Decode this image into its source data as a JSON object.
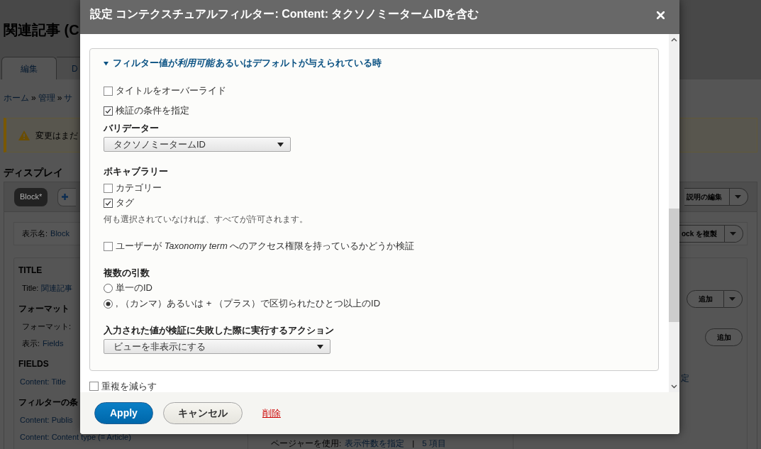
{
  "page": {
    "title": "関連記事 (C",
    "tabs": [
      {
        "label": "編集",
        "selected": true
      },
      {
        "label": "D",
        "selected": false
      }
    ],
    "breadcrumb": [
      {
        "kind": "link",
        "text": "ホーム"
      },
      {
        "kind": "separator",
        "text": "»"
      },
      {
        "kind": "link",
        "text": "管理"
      },
      {
        "kind": "separator",
        "text": "»"
      },
      {
        "kind": "link",
        "text": "サ"
      }
    ],
    "warning": "変更はまだ",
    "displays_heading": "ディスプレイ",
    "display_tabs": [
      {
        "label": "Block*",
        "selected": true
      }
    ],
    "display_menu": {
      "label": "説明の編集",
      "dropdown": true
    },
    "display_name": {
      "label": "表示名:",
      "value": "Block"
    },
    "clone_button": {
      "label": "ock を複製",
      "dropdown": true
    },
    "left_sections": [
      {
        "heading": "TITLE",
        "rows": [
          {
            "label": "Title:",
            "value": "関連記事"
          }
        ]
      },
      {
        "heading": "フォーマット",
        "rows": [
          {
            "label": "フォーマット:"
          },
          {
            "label": "表示:",
            "value": "Fields"
          }
        ]
      },
      {
        "heading": "FIELDS",
        "rows": [
          {
            "value": "Content: Title"
          }
        ]
      },
      {
        "heading": "フィルターの条",
        "rows": [
          {
            "value": "Content: Publis"
          },
          {
            "value": "Content: Content type (= Article)"
          }
        ]
      }
    ],
    "pager": {
      "label": "ページャーを使用:",
      "link": "表示件数を指定",
      "separator": "|",
      "count": "5 項目"
    },
    "right_buttons": [
      {
        "label": "追加",
        "dropdown": true
      },
      {
        "label": "追加",
        "dropdown": false
      }
    ],
    "right_link": "定"
  },
  "dialog": {
    "title": "設定 コンテクスチュアルフィルター: Content: タクソノミータームIDを含む",
    "fieldset": {
      "summary": [
        {
          "text": "フィルター値が",
          "italic": false
        },
        {
          "text": "利用可能",
          "italic": true
        },
        {
          "text": "あるいはデフォルトが与えられている時",
          "italic": false
        }
      ],
      "expanded": true,
      "items": [
        {
          "kind": "checkbox",
          "label": "タイトルをオーバーライド",
          "checked": false
        },
        {
          "kind": "checkbox",
          "label": "検証の条件を指定",
          "checked": true
        },
        {
          "kind": "select",
          "label": "バリデーター",
          "value": "タクソノミータームID"
        },
        {
          "kind": "checkboxes",
          "label": "ボキャブラリー",
          "options": [
            {
              "label": "カテゴリー",
              "checked": false
            },
            {
              "label": "タグ",
              "checked": true
            }
          ],
          "description": "何も選択されていなければ、すべてが許可されます。"
        },
        {
          "kind": "checkbox",
          "label": "ユーザーが *Taxonomy term* へのアクセス権限を持っているかどうか検証",
          "checked": false
        },
        {
          "kind": "radios",
          "label": "複数の引数",
          "options": [
            {
              "label": "単一のID",
              "selected": false
            },
            {
              "label": ", （カンマ）あるいは + （プラス）で区切られたひとつ以上のID",
              "selected": true
            }
          ]
        },
        {
          "kind": "select",
          "label": "入力された値が検証に失敗した際に実行するアクション",
          "value": "ビューを非表示にする"
        }
      ]
    },
    "after_fieldset": [
      {
        "label": "重複を減らす",
        "checked": false
      }
    ],
    "buttons": [
      {
        "kind": "primary",
        "label": "Apply"
      },
      {
        "kind": "secondary",
        "label": "キャンセル"
      },
      {
        "kind": "link",
        "label": "削除"
      }
    ]
  }
}
